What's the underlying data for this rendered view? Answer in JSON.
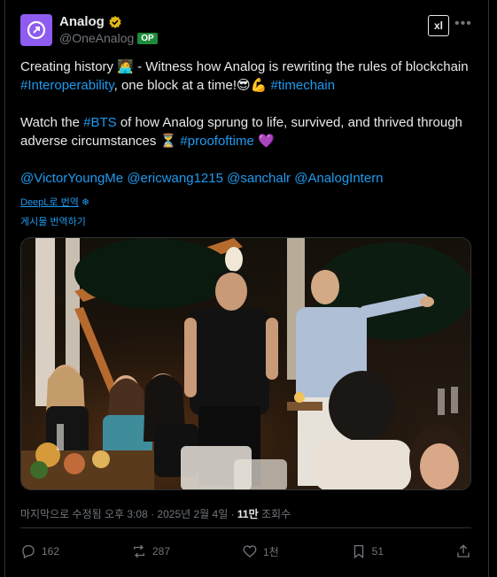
{
  "author": {
    "display_name": "Analog",
    "handle": "@OneAnalog",
    "badge": "OP"
  },
  "brand_mark": "xl",
  "tweet": {
    "line1_a": "Creating history ",
    "line1_emoji": "🧑‍💻",
    "line1_b": " - Witness how Analog is rewriting the rules of blockchain ",
    "tag_interop": "#Interoperability",
    "line1_c": ", one block at a time!",
    "line1_emoji2": "😎💪",
    "tag_timechain": "#timechain",
    "line2_a": "Watch the ",
    "tag_bts": "#BTS",
    "line2_b": " of how Analog sprung to life, survived, and thrived through adverse circumstances ",
    "line2_emoji": "⏳",
    "tag_proofoftime": "#proofoftime",
    "line2_emoji2": "💜",
    "mention1": "@VictorYoungMe",
    "mention2": "@ericwang1215",
    "mention3": "@sanchalr",
    "mention4": "@AnalogIntern"
  },
  "translate": {
    "deepl_label": "DeepL로 번역",
    "translate_post": "게시물 번역하기"
  },
  "meta": {
    "prefix": "마지막으로 수정됨 오후 3:08 · 2025년 2월 4일 · ",
    "views": "11만",
    "views_label": " 조회수"
  },
  "actions": {
    "replies": "162",
    "reposts": "287",
    "likes": "1천",
    "bookmarks": "51"
  },
  "colors": {
    "link": "#1d9bf0",
    "avatar": "#8e5cf0",
    "badge": "#1f8a3a",
    "muted": "#71767b"
  }
}
